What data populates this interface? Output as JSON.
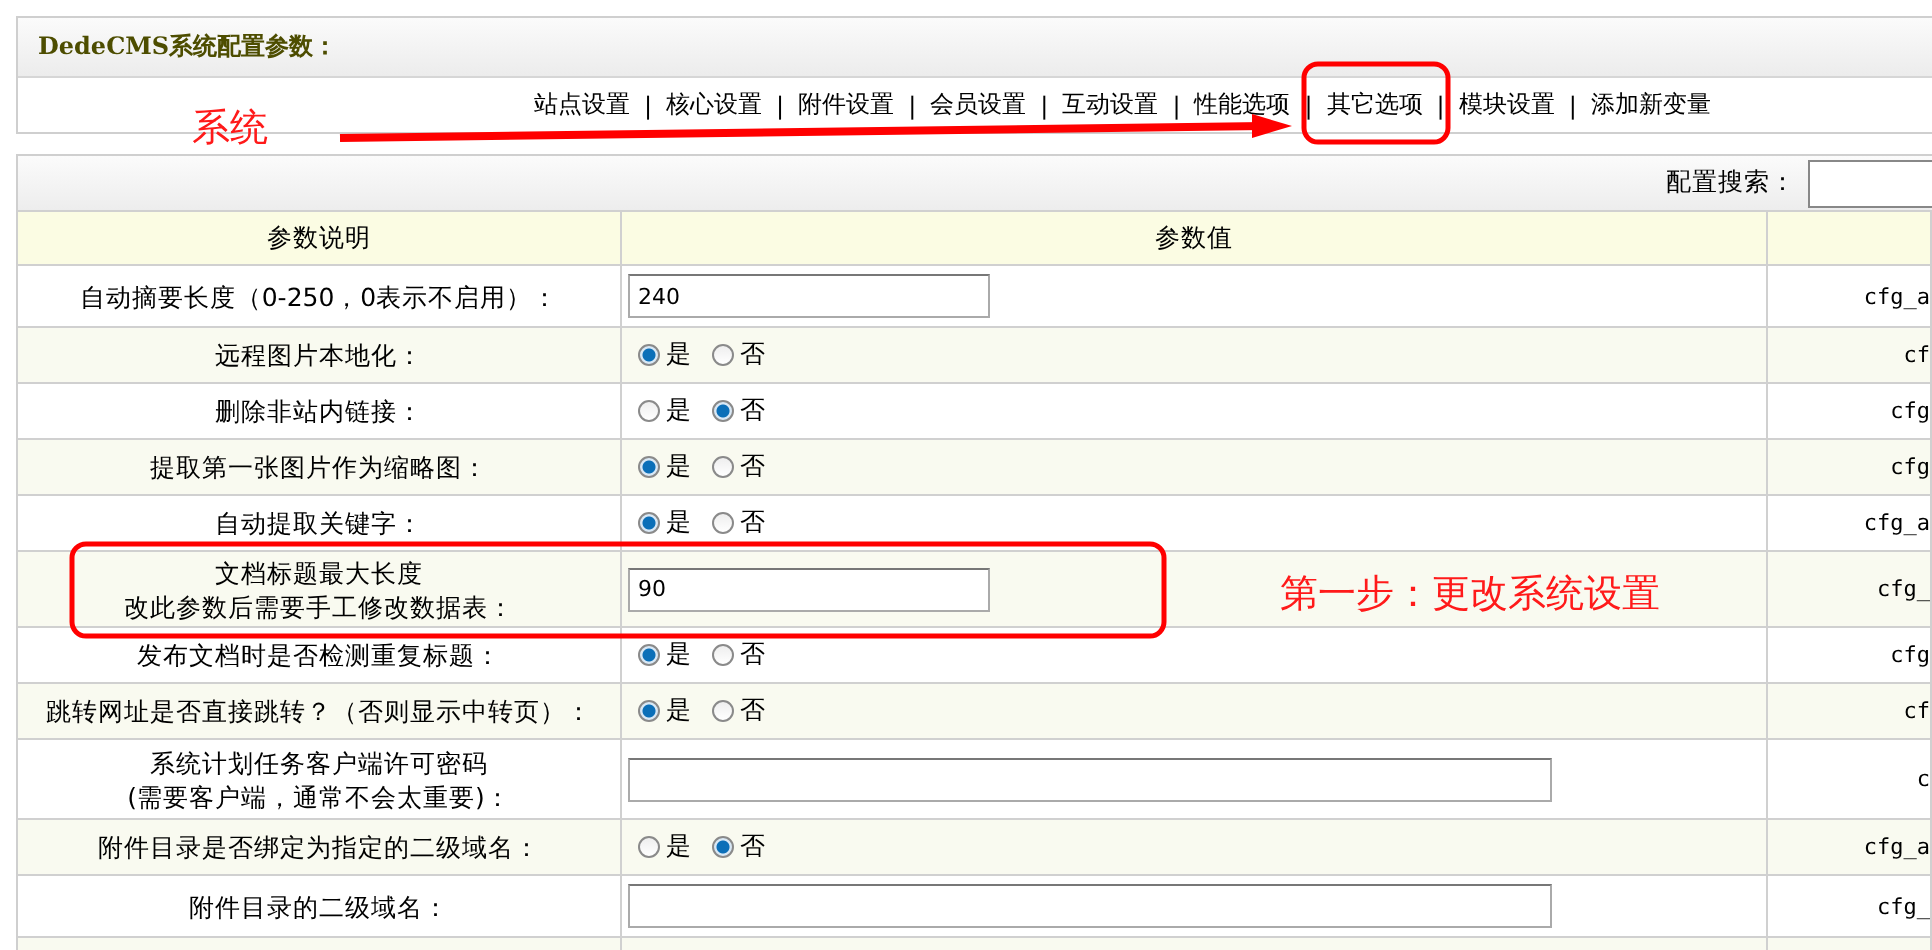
{
  "panel_title": "DedeCMS系统配置参数：",
  "nav": [
    {
      "label": "站点设置"
    },
    {
      "label": "核心设置"
    },
    {
      "label": "附件设置"
    },
    {
      "label": "会员设置"
    },
    {
      "label": "互动设置"
    },
    {
      "label": "性能选项"
    },
    {
      "label": "其它选项"
    },
    {
      "label": "模块设置"
    },
    {
      "label": "添加新变量"
    }
  ],
  "nav_separator": "|",
  "search": {
    "label": "配置搜索："
  },
  "table": {
    "columns": [
      "参数说明",
      "参数值"
    ],
    "rows": [
      {
        "description": [
          "自动摘要长度（0-250，0表示不启用）："
        ],
        "kind": "text",
        "value": "240",
        "wide": false,
        "code": "cfg_a"
      },
      {
        "description": [
          "远程图片本地化："
        ],
        "kind": "radio",
        "options": [
          {
            "label": "是",
            "selected": true
          },
          {
            "label": "否",
            "selected": false
          }
        ],
        "code": "cf"
      },
      {
        "description": [
          "删除非站内链接："
        ],
        "kind": "radio",
        "options": [
          {
            "label": "是",
            "selected": false
          },
          {
            "label": "否",
            "selected": true
          }
        ],
        "code": "cfg"
      },
      {
        "description": [
          "提取第一张图片作为缩略图："
        ],
        "kind": "radio",
        "options": [
          {
            "label": "是",
            "selected": true
          },
          {
            "label": "否",
            "selected": false
          }
        ],
        "code": "cfg"
      },
      {
        "description": [
          "自动提取关键字："
        ],
        "kind": "radio",
        "options": [
          {
            "label": "是",
            "selected": true
          },
          {
            "label": "否",
            "selected": false
          }
        ],
        "code": "cfg_a"
      },
      {
        "description": [
          "文档标题最大长度",
          "改此参数后需要手工修改数据表："
        ],
        "kind": "text",
        "value": "90",
        "wide": false,
        "code": "cfg_"
      },
      {
        "description": [
          "发布文档时是否检测重复标题："
        ],
        "kind": "radio",
        "options": [
          {
            "label": "是",
            "selected": true
          },
          {
            "label": "否",
            "selected": false
          }
        ],
        "code": "cfg"
      },
      {
        "description": [
          "跳转网址是否直接跳转？（否则显示中转页）："
        ],
        "kind": "radio",
        "options": [
          {
            "label": "是",
            "selected": true
          },
          {
            "label": "否",
            "selected": false
          }
        ],
        "code": "cf"
      },
      {
        "description": [
          "系统计划任务客户端许可密码",
          "(需要客户端，通常不会太重要)："
        ],
        "kind": "text",
        "wide": true,
        "code": "c"
      },
      {
        "description": [
          "附件目录是否绑定为指定的二级域名："
        ],
        "kind": "radio",
        "options": [
          {
            "label": "是",
            "selected": false
          },
          {
            "label": "否",
            "selected": true
          }
        ],
        "code": "cfg_a"
      },
      {
        "description": [
          "附件目录的二级域名："
        ],
        "kind": "text",
        "wide": true,
        "code": "cfg_"
      }
    ]
  },
  "annotations": {
    "nav_label": "系统",
    "step_note": "第一步：更改系统设置"
  }
}
